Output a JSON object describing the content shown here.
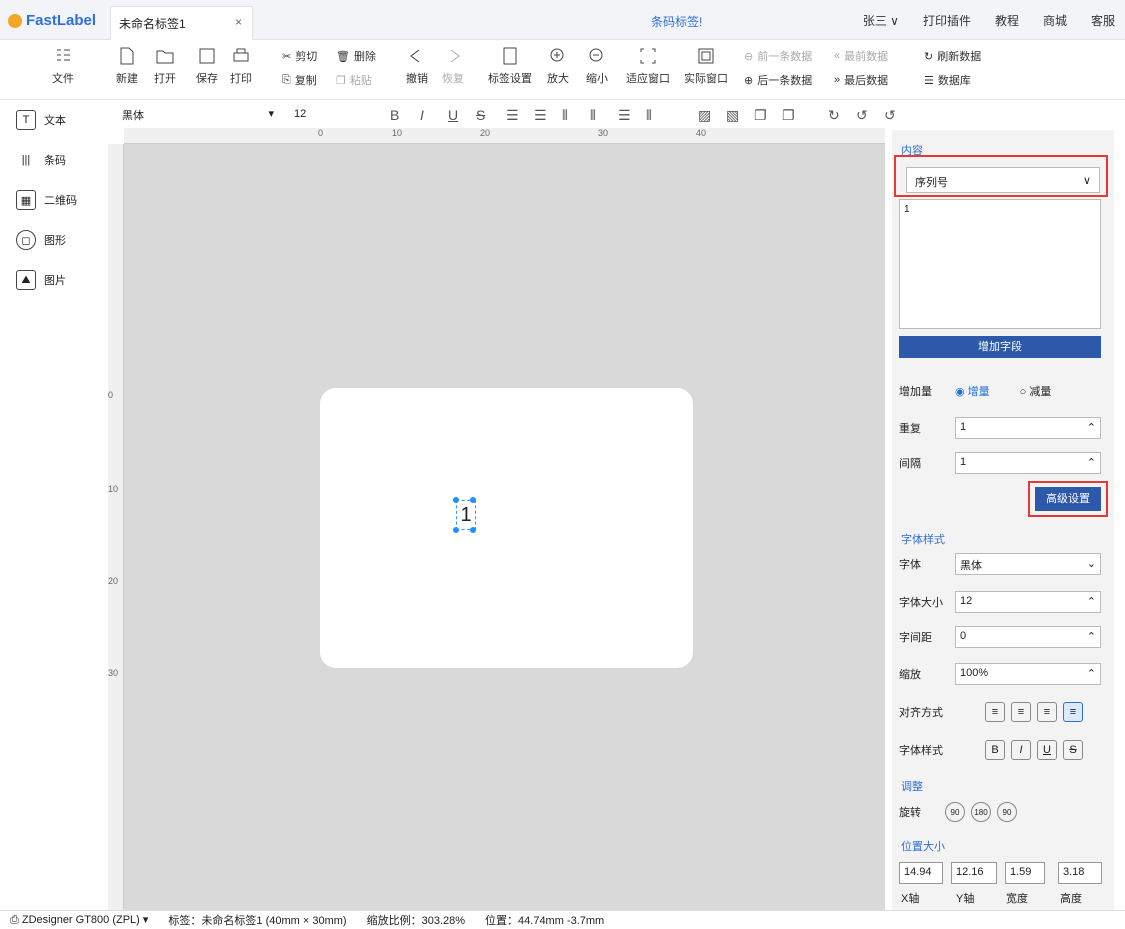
{
  "app": {
    "name": "FastLabel",
    "tab": "未命名标签1",
    "tab_close": "×",
    "center_title": "条码标签!",
    "user": "张三 ∨",
    "print_plugin": "打印插件",
    "tutorial": "教程",
    "mall": "商城",
    "service": "客服"
  },
  "toolbar": {
    "file": "文件",
    "new": "新建",
    "open": "打开",
    "save": "保存",
    "print": "打印",
    "cut": "剪切",
    "delete": "删除",
    "copy": "复制",
    "paste": "粘贴",
    "undo": "撤销",
    "redo": "恢复",
    "label_settings": "标签设置",
    "zoom_in": "放大",
    "zoom_out": "缩小",
    "fit_window": "适应窗口",
    "actual_window": "实际窗口",
    "prev_record": "前一条数据",
    "first_record": "最前数据",
    "refresh_data": "刷新数据",
    "next_record": "后一条数据",
    "last_record": "最后数据",
    "database": "数据库"
  },
  "format": {
    "font": "黑体",
    "size": "12"
  },
  "left": {
    "text": "文本",
    "barcode": "条码",
    "qrcode": "二维码",
    "shape": "图形",
    "image": "图片"
  },
  "rulers": {
    "top": [
      "0",
      "10",
      "20",
      "30",
      "40"
    ],
    "left": [
      "0",
      "10",
      "20",
      "30"
    ]
  },
  "canvas": {
    "element_text": "1"
  },
  "right": {
    "content_head": "内容",
    "content_type": "序列号",
    "content_value": "1",
    "add_field": "增加字段",
    "increment_label": "增加量",
    "increment": "增量",
    "decrement": "减量",
    "repeat_label": "重复",
    "repeat": "1",
    "interval_label": "间隔",
    "interval": "1",
    "advanced": "高级设置",
    "font_style_head": "字体样式",
    "font_label": "字体",
    "font": "黑体",
    "font_size_label": "字体大小",
    "font_size": "12",
    "spacing_label": "字间距",
    "spacing": "0",
    "scale_label": "缩放",
    "scale": "100%",
    "align_label": "对齐方式",
    "style_label": "字体样式",
    "adjust_head": "调整",
    "rotate_label": "旋转",
    "rot90": "90",
    "rot180": "180",
    "rot90b": "90",
    "pos_head": "位置大小",
    "x": "14.94",
    "y": "12.16",
    "w": "1.59",
    "h": "3.18",
    "x_label": "X轴",
    "y_label": "Y轴",
    "w_label": "宽度",
    "h_label": "高度"
  },
  "status": {
    "printer": "ZDesigner GT800 (ZPL)",
    "label": "标签：未命名标签1 (40mm × 30mm)",
    "zoom": "缩放比例：303.28%",
    "position": "位置：44.74mm -3.7mm"
  }
}
